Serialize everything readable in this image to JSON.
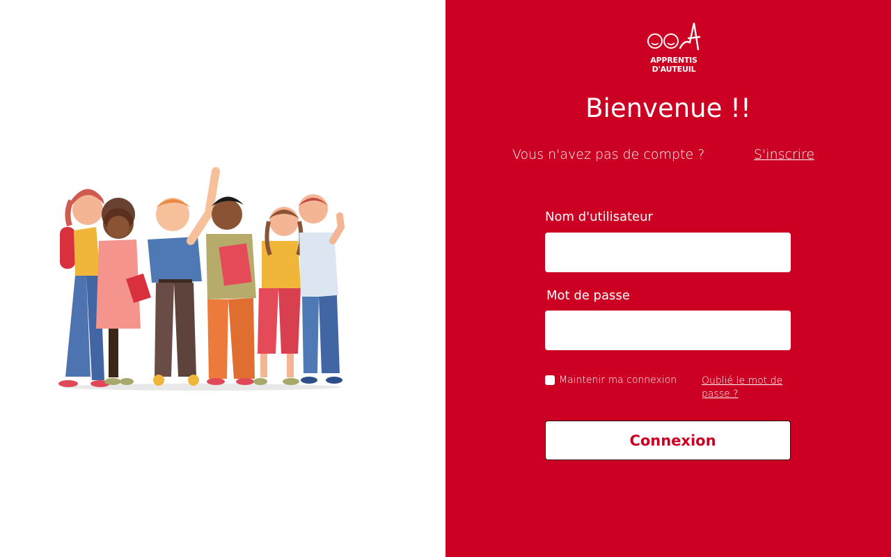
{
  "brand": {
    "logo_line1": "APPRENTIS",
    "logo_line2": "D'AUTEUIL",
    "color": "#cc0022"
  },
  "login": {
    "title": "Bienvenue !!",
    "no_account_text": "Vous n'avez pas de compte ?",
    "signup_label": "S'inscrire",
    "username_label": "Nom d'utilisateur",
    "username_value": "",
    "password_label": "Mot de passe",
    "password_value": "",
    "remember_label": "Maintenir ma connexion",
    "remember_checked": false,
    "forgot_label": "Oublié le mot de passe ?",
    "submit_label": "Connexion"
  },
  "illustration": {
    "icon": "group-of-students-illustration"
  }
}
